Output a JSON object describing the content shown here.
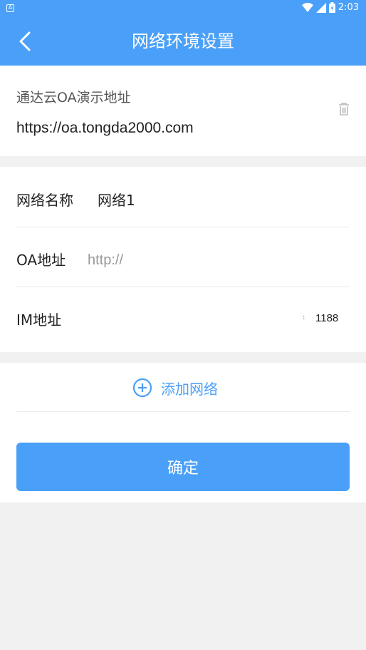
{
  "statusbar": {
    "notif_icon": "A",
    "time": "2:03",
    "icons": [
      "wifi-icon",
      "signal-icon",
      "battery-icon"
    ]
  },
  "header": {
    "title": "网络环境设置",
    "back_icon": "chevron-left-icon"
  },
  "saved_network": {
    "name": "通达云OA演示地址",
    "url": "https://oa.tongda2000.com",
    "delete_icon": "trash-icon"
  },
  "form": {
    "network_name_label": "网络名称",
    "network_name_value": "网络1",
    "oa_address_label": "OA地址",
    "oa_address_value": "",
    "oa_address_placeholder": "http://",
    "im_address_label": "IM地址",
    "im_address_value": "",
    "im_port_separator": ":",
    "im_port": "1188"
  },
  "add_network": {
    "label": "添加网络",
    "icon": "plus-circle-icon"
  },
  "confirm_label": "确定",
  "colors": {
    "primary": "#4aa0f8",
    "background": "#f1f1f1"
  }
}
